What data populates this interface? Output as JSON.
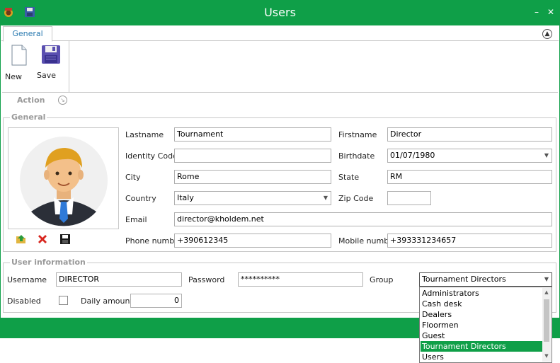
{
  "window": {
    "title": "Users",
    "minimize": "–",
    "close": "✕",
    "icons": [
      "app-logo-icon",
      "save-icon"
    ]
  },
  "tabs": {
    "general": "General"
  },
  "ribbon": {
    "new_label": "New",
    "save_label": "Save",
    "group_label": "Action"
  },
  "general": {
    "legend": "General",
    "lastname_label": "Lastname",
    "lastname_value": "Tournament",
    "firstname_label": "Firstname",
    "firstname_value": "Director",
    "identity_label": "Identity Code",
    "identity_value": "",
    "birthdate_label": "Birthdate",
    "birthdate_value": "01/07/1980",
    "city_label": "City",
    "city_value": "Rome",
    "state_label": "State",
    "state_value": "RM",
    "country_label": "Country",
    "country_value": "Italy",
    "zip_label": "Zip Code",
    "zip_value": "",
    "email_label": "Email",
    "email_value": "director@kholdem.net",
    "phone_label": "Phone number",
    "phone_value": "+390612345",
    "mobile_label": "Mobile number",
    "mobile_value": "+393331234657"
  },
  "user_info": {
    "legend": "User information",
    "username_label": "Username",
    "username_value": "DIRECTOR",
    "password_label": "Password",
    "password_value": "**********",
    "group_label": "Group",
    "group_value": "Tournament Directors",
    "disabled_label": "Disabled",
    "disabled_checked": false,
    "daily_label": "Daily amount",
    "daily_value": "0"
  },
  "group_options": [
    "Administrators",
    "Cash desk",
    "Dealers",
    "Floormen",
    "Guest",
    "Tournament Directors",
    "Users"
  ],
  "selected_group_index": 5,
  "colors": {
    "accent": "#0f9f48",
    "tab_text": "#2a7ab0"
  }
}
